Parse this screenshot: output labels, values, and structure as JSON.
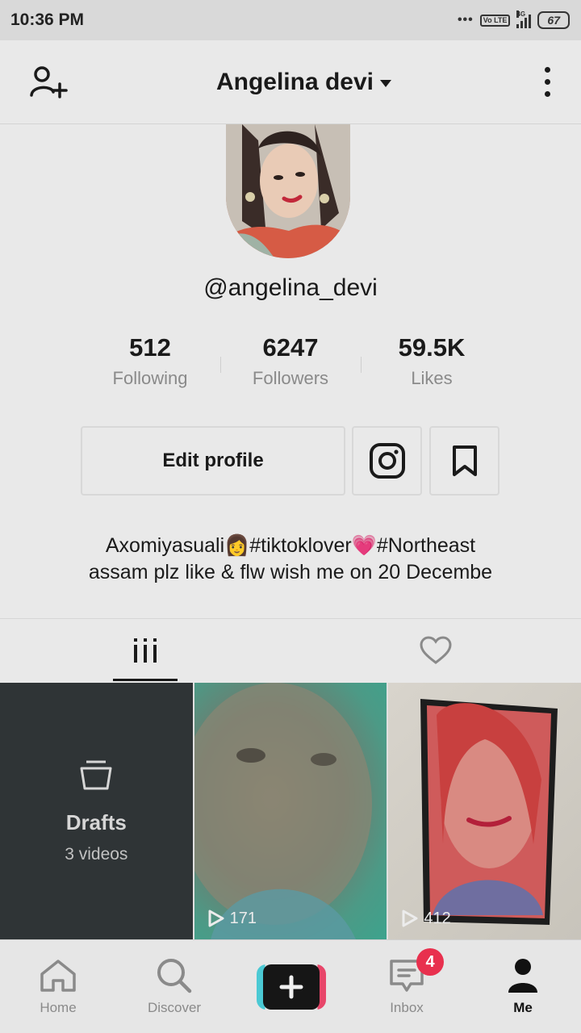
{
  "status_bar": {
    "time": "10:36 PM",
    "dots": "•••",
    "volte": "Vo LTE",
    "network": "4G",
    "battery": "67"
  },
  "header": {
    "title": "Angelina devi",
    "add_user_icon": "add-user-icon",
    "menu_icon": "more-vertical-icon"
  },
  "profile": {
    "handle": "@angelina_devi",
    "stats": [
      {
        "value": "512",
        "label": "Following"
      },
      {
        "value": "6247",
        "label": "Followers"
      },
      {
        "value": "59.5K",
        "label": "Likes"
      }
    ],
    "edit_label": "Edit profile",
    "bio_line1": "Axomiyasuali👩#tiktoklover💗#Northeast",
    "bio_line2": "assam plz like & flw wish me on 20 Decembe"
  },
  "tabs": [
    {
      "icon": "grid-icon",
      "active": true
    },
    {
      "icon": "heart-icon",
      "active": false
    }
  ],
  "videos": {
    "drafts": {
      "title": "Drafts",
      "subtitle": "3 videos"
    },
    "items": [
      {
        "views": "171"
      },
      {
        "views": "412"
      }
    ]
  },
  "bottom_nav": [
    {
      "label": "Home",
      "icon": "home-icon"
    },
    {
      "label": "Discover",
      "icon": "search-icon"
    },
    {
      "label": "",
      "icon": "plus-icon"
    },
    {
      "label": "Inbox",
      "icon": "inbox-icon",
      "badge": "4"
    },
    {
      "label": "Me",
      "icon": "profile-icon",
      "active": true
    }
  ],
  "colors": {
    "background": "#e9e9e9",
    "text": "#1a1a1a",
    "muted": "#8a8a8a",
    "badge": "#e8304e",
    "create_left": "#4bc9d4",
    "create_right": "#e8466a"
  }
}
